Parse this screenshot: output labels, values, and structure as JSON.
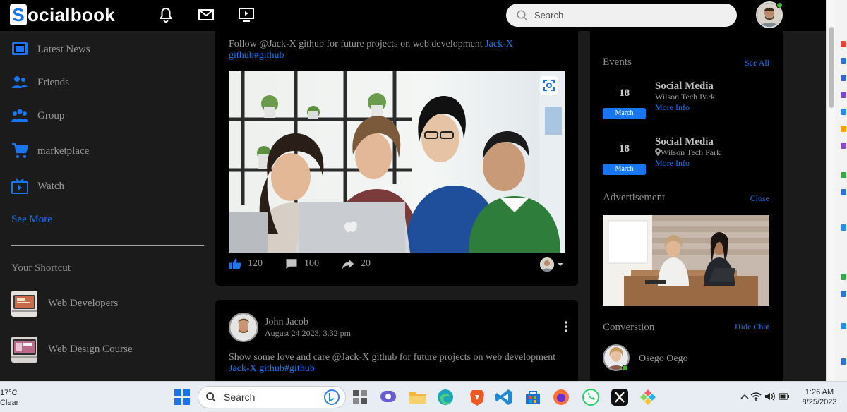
{
  "navbar": {
    "logo_letter": "S",
    "logo_rest": "ocialbook",
    "search_placeholder": "Search"
  },
  "sidebar": {
    "items": [
      {
        "label": "Latest News"
      },
      {
        "label": "Friends"
      },
      {
        "label": "Group"
      },
      {
        "label": "marketplace"
      },
      {
        "label": "Watch"
      }
    ],
    "see_more": "See More",
    "shortcut_title": "Your Shortcut",
    "shortcuts": [
      {
        "label": "Web Developers"
      },
      {
        "label": "Web Design Course"
      }
    ]
  },
  "feed": {
    "post1": {
      "text_plain": "Follow @Jack-X github for future projects on web development ",
      "text_link1": "Jack-X",
      "text_link2": "github#github",
      "likes": "120",
      "comments": "100",
      "shares": "20"
    },
    "post2": {
      "author": "John Jacob",
      "date": "August 24 2023, 3.32 pm",
      "text_plain": "Show some love and care @Jack-X github for future projects on web development",
      "text_link": "Jack-X github#github"
    }
  },
  "right": {
    "events_title": "Events",
    "see_all": "See All",
    "events": [
      {
        "day": "18",
        "month": "March",
        "title": "Social Media",
        "place": "Wilson Tech Park",
        "more": "More Info"
      },
      {
        "day": "18",
        "month": "March",
        "title": "Social Media",
        "place": "Wilson Tech Park",
        "more": "More Info"
      }
    ],
    "ad_title": "Advertisement",
    "close": "Close",
    "chat_title": "Converstion",
    "hide_chat": "Hide Chat",
    "chat_user": "Osego Oego"
  },
  "taskbar": {
    "temp": "17°C",
    "weather": "Clear",
    "search": "Search",
    "time": "1:26 AM",
    "date": "8/25/2023"
  },
  "colors": {
    "accent": "#1876f2",
    "background": "#1b1b1b",
    "card": "#000000",
    "online": "#41b32b"
  }
}
